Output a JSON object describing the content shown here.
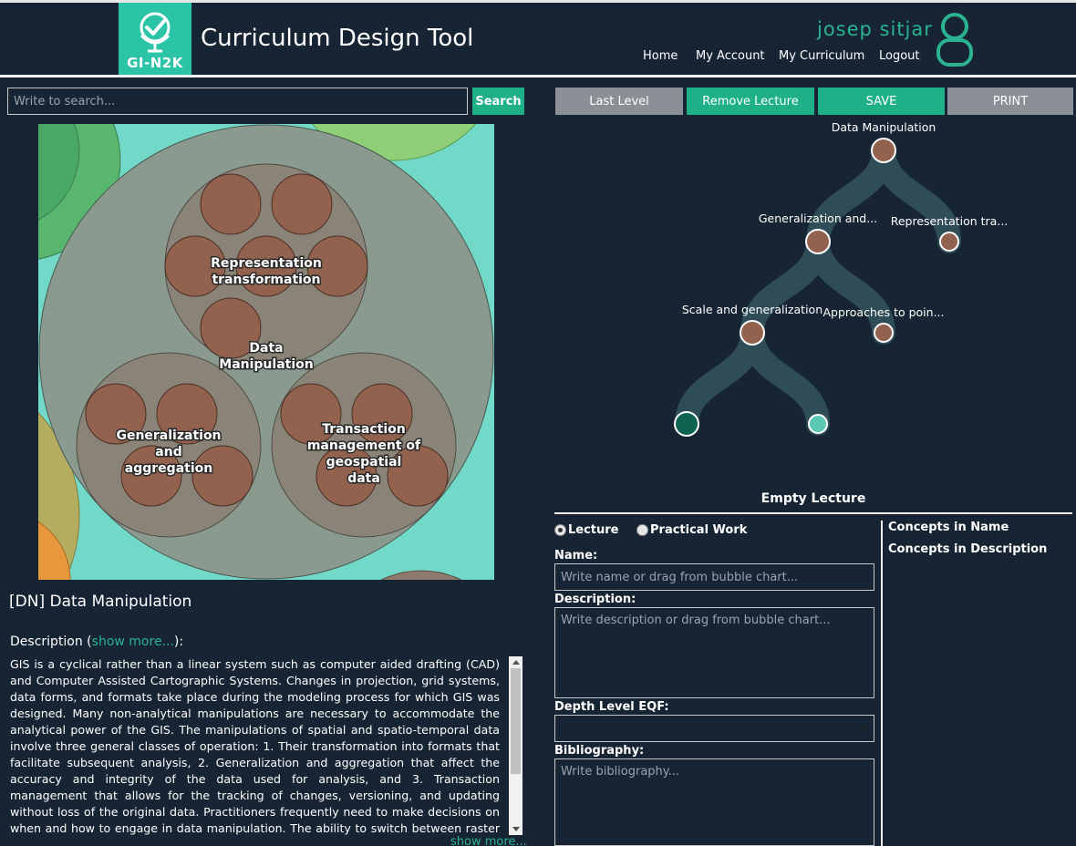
{
  "header": {
    "logo_text": "GI-N2K",
    "title": "Curriculum Design Tool",
    "user_name": "josep sitjar",
    "nav": [
      "Home",
      "My Account",
      "My Curriculum",
      "Logout"
    ]
  },
  "search": {
    "placeholder": "Write to search...",
    "button": "Search"
  },
  "bubble_chart": {
    "labels": {
      "data_manipulation": [
        "Data",
        "Manipulation"
      ],
      "representation": [
        "Representation",
        "transformation"
      ],
      "generalization": [
        "Generalization",
        "and",
        "aggregation"
      ],
      "transaction": [
        "Transaction",
        "management of",
        "geospatial",
        "data"
      ]
    }
  },
  "detail": {
    "title": "[DN] Data Manipulation",
    "description_prefix": "Description (",
    "show_more": "show more...",
    "description_suffix": "):",
    "description_text": "GIS is a cyclical rather than a linear system such as computer aided drafting (CAD) and Computer Assisted Cartographic Systems. Changes in projection, grid systems, data forms, and formats take place during the modeling process for which GIS was designed. Many non-analytical manipulations are necessary to accommodate the analytical power of the GIS. The manipulations of spatial and spatio-temporal data involve three general classes of operation: 1. Their transformation into formats that facilitate subsequent analysis, 2. Generalization and aggregation that affect the accuracy and integrity of the data used for analysis, and 3. Transaction management that allows for the tracking of changes, versioning, and updating without loss of the original data. Practitioners frequently need to make decisions on when and how to engage in data manipulation. The ability to switch between raster and vector systems without substantial information",
    "show_more_bottom": "show more..."
  },
  "toolbar": {
    "last_level": "Last Level",
    "remove_lecture": "Remove Lecture",
    "save": "SAVE",
    "print": "PRINT"
  },
  "tree": {
    "root": "Data Manipulation",
    "level1": [
      "Generalization and...",
      "Representation tra..."
    ],
    "level2": [
      "Scale and generalization",
      "Approaches to poin..."
    ]
  },
  "lecture": {
    "title": "Empty Lecture",
    "type_options": [
      "Lecture",
      "Practical Work"
    ],
    "name_label": "Name:",
    "name_placeholder": "Write name or drag from bubble chart...",
    "description_label": "Description:",
    "description_placeholder": "Write description or drag from bubble chart...",
    "depth_label": "Depth Level EQF:",
    "bibliography_label": "Bibliography:",
    "bibliography_placeholder": "Write bibliography...",
    "concepts_name": "Concepts in Name",
    "concepts_description": "Concepts in Description"
  },
  "colors": {
    "background": "#162433",
    "accent": "#1fb088",
    "button_grey": "#8b9096",
    "bubble_fill": "#8a9a8e",
    "leaf_fill": "#93624f"
  }
}
